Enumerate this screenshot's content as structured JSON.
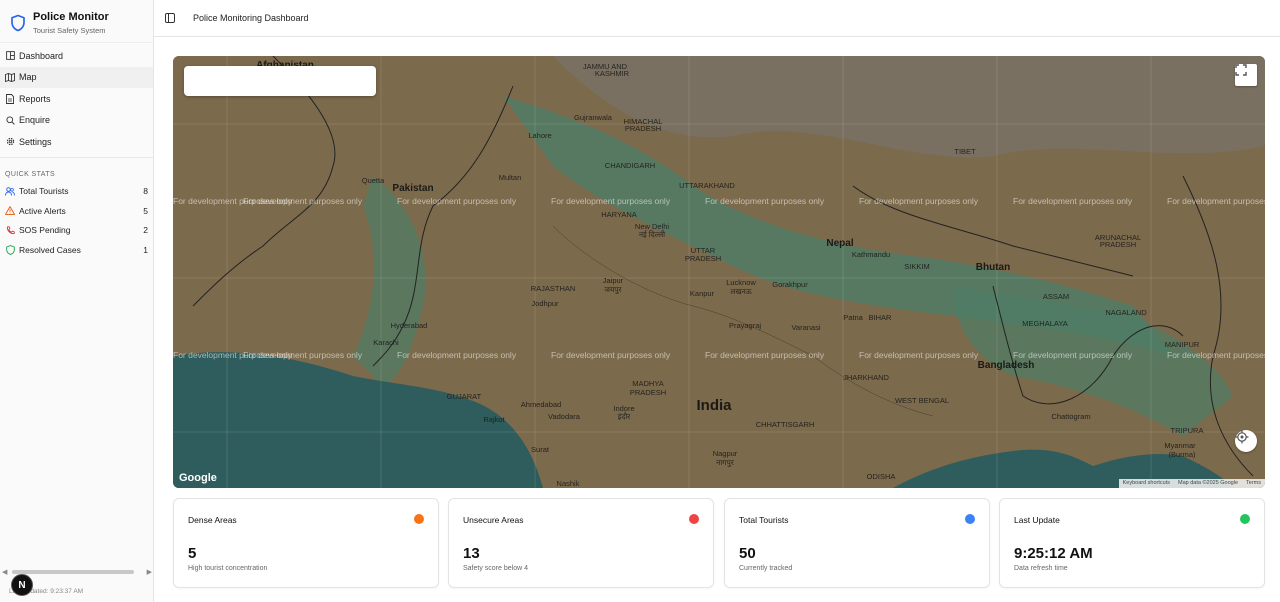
{
  "app": {
    "title": "Police Monitor",
    "subtitle": "Tourist Safety System"
  },
  "nav": [
    {
      "label": "Dashboard",
      "icon": "dashboard-icon",
      "active": false
    },
    {
      "label": "Map",
      "icon": "map-icon",
      "active": true
    },
    {
      "label": "Reports",
      "icon": "reports-icon",
      "active": false
    },
    {
      "label": "Enquire",
      "icon": "search-icon",
      "active": false
    },
    {
      "label": "Settings",
      "icon": "gear-icon",
      "active": false
    }
  ],
  "quick_stats": {
    "title": "QUICK STATS",
    "items": [
      {
        "label": "Total Tourists",
        "count": "8",
        "icon": "users-icon",
        "color": "#2563eb"
      },
      {
        "label": "Active Alerts",
        "count": "5",
        "icon": "alert-triangle-icon",
        "color": "#ea580c"
      },
      {
        "label": "SOS Pending",
        "count": "2",
        "icon": "phone-icon",
        "color": "#dc2626"
      },
      {
        "label": "Resolved Cases",
        "count": "1",
        "icon": "shield-check-icon",
        "color": "#16a34a"
      }
    ]
  },
  "footer": {
    "last_updated": "Last updated: 9:23:37 AM",
    "avatar_letter": "N"
  },
  "header": {
    "title": "Police Monitoring Dashboard"
  },
  "map": {
    "watermark": "For development purposes only",
    "google": "Google",
    "footer_links": [
      "Keyboard shortcuts",
      "Map data ©2025 Google",
      "Terms"
    ],
    "labels": [
      {
        "text": "Afghanistan",
        "bold": true
      },
      {
        "text": "JAMMU AND"
      },
      {
        "text": "KASHMIR"
      },
      {
        "text": "HIMACHAL"
      },
      {
        "text": "PRADESH"
      },
      {
        "text": "Lahore"
      },
      {
        "text": "Gujranwala"
      },
      {
        "text": "CHANDIGARH"
      },
      {
        "text": "UTTARAKHAND"
      },
      {
        "text": "TIBET"
      },
      {
        "text": "Pakistan",
        "bold": true
      },
      {
        "text": "Multan"
      },
      {
        "text": "Quetta"
      },
      {
        "text": "HARYANA"
      },
      {
        "text": "New Delhi"
      },
      {
        "text": "नई दिल्ली"
      },
      {
        "text": "Nepal",
        "bold": true
      },
      {
        "text": "Kathmandu"
      },
      {
        "text": "UTTAR"
      },
      {
        "text": "PRADESH"
      },
      {
        "text": "SIKKIM"
      },
      {
        "text": "Bhutan",
        "bold": true
      },
      {
        "text": "ARUNACHAL"
      },
      {
        "text": "PRADESH"
      },
      {
        "text": "RAJASTHAN"
      },
      {
        "text": "Jaipur"
      },
      {
        "text": "जयपुर"
      },
      {
        "text": "Lucknow"
      },
      {
        "text": "लखनऊ"
      },
      {
        "text": "Gorakhpur"
      },
      {
        "text": "ASSAM"
      },
      {
        "text": "NAGALAND"
      },
      {
        "text": "Jodhpur"
      },
      {
        "text": "Kanpur"
      },
      {
        "text": "Patna"
      },
      {
        "text": "BIHAR"
      },
      {
        "text": "MEGHALAYA"
      },
      {
        "text": "Hyderabad"
      },
      {
        "text": "Karachi"
      },
      {
        "text": "Prayagraj"
      },
      {
        "text": "Varanasi"
      },
      {
        "text": "MANIPUR"
      },
      {
        "text": "Bangladesh",
        "bold": true
      },
      {
        "text": "MADHYA"
      },
      {
        "text": "PRADESH"
      },
      {
        "text": "JHARKHAND"
      },
      {
        "text": "GUJARAT"
      },
      {
        "text": "Ahmedabad"
      },
      {
        "text": "Indore"
      },
      {
        "text": "इंदौर"
      },
      {
        "text": "India",
        "bold": true
      },
      {
        "text": "WEST BENGAL"
      },
      {
        "text": "TRIPURA"
      },
      {
        "text": "Chattogram"
      },
      {
        "text": "Rajkot"
      },
      {
        "text": "Vadodara"
      },
      {
        "text": "CHHATTISGARH"
      },
      {
        "text": "Myanmar"
      },
      {
        "text": "(Burma)"
      },
      {
        "text": "Surat"
      },
      {
        "text": "Nagpur"
      },
      {
        "text": "नागपुर"
      },
      {
        "text": "ODISHA"
      },
      {
        "text": "Nashik"
      }
    ]
  },
  "cards": [
    {
      "title": "Dense Areas",
      "value": "5",
      "sub": "High tourist concentration",
      "color": "#f97316"
    },
    {
      "title": "Unsecure Areas",
      "value": "13",
      "sub": "Safety score below 4",
      "color": "#ef4444"
    },
    {
      "title": "Total Tourists",
      "value": "50",
      "sub": "Currently tracked",
      "color": "#3b82f6"
    },
    {
      "title": "Last Update",
      "value": "9:25:12 AM",
      "sub": "Data refresh time",
      "color": "#22c55e"
    }
  ]
}
